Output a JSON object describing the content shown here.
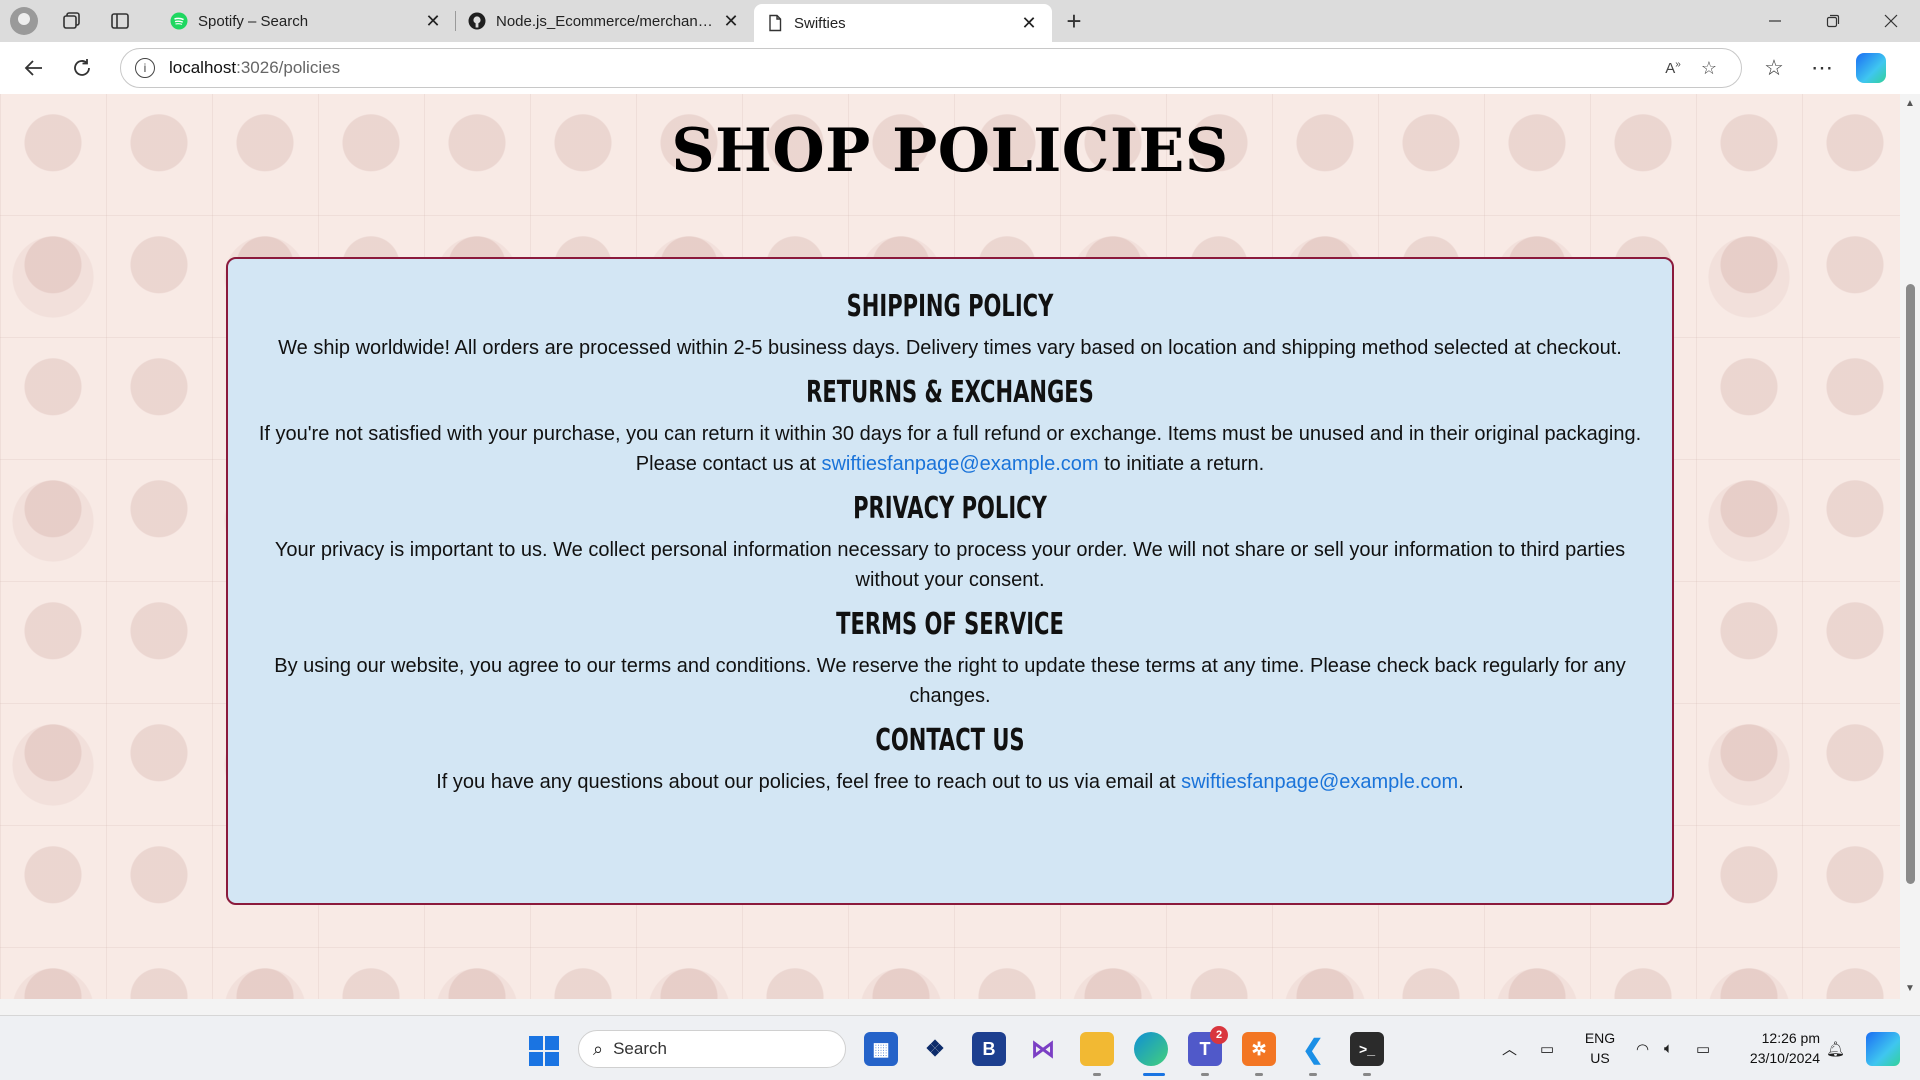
{
  "browser": {
    "tabs": [
      {
        "title": "Spotify – Search",
        "icon": "spotify-icon"
      },
      {
        "title": "Node.js_Ecommerce/merchandise",
        "icon": "github-icon"
      },
      {
        "title": "Swifties",
        "icon": "page-icon",
        "active": true
      }
    ],
    "address": {
      "host": "localhost",
      "path": ":3026/policies"
    }
  },
  "page": {
    "title": "SHOP POLICIES",
    "sections": [
      {
        "heading": "Shipping Policy",
        "text": "We ship worldwide! All orders are processed within 2-5 business days. Delivery times vary based on location and shipping method selected at checkout."
      },
      {
        "heading": "Returns & Exchanges",
        "text_before": "If you're not satisfied with your purchase, you can return it within 30 days for a full refund or exchange. Items must be unused and in their original packaging. Please contact us at ",
        "link": "swiftiesfanpage@example.com",
        "text_after": " to initiate a return."
      },
      {
        "heading": "Privacy Policy",
        "text": "Your privacy is important to us. We collect personal information necessary to process your order. We will not share or sell your information to third parties without your consent."
      },
      {
        "heading": "Terms of Service",
        "text": "By using our website, you agree to our terms and conditions. We reserve the right to update these terms at any time. Please check back regularly for any changes."
      },
      {
        "heading": "Contact Us",
        "text_before": "If you have any questions about our policies, feel free to reach out to us via email at ",
        "link": "swiftiesfanpage@example.com",
        "text_after": "."
      }
    ]
  },
  "taskbar": {
    "search_placeholder": "Search",
    "teams_badge": "2",
    "language": "ENG",
    "region": "US",
    "time": "12:26 pm",
    "date": "23/10/2024"
  },
  "colors": {
    "card_bg": "#d3e6f4",
    "card_border": "#8b1a3c",
    "link": "#1a73d9"
  }
}
